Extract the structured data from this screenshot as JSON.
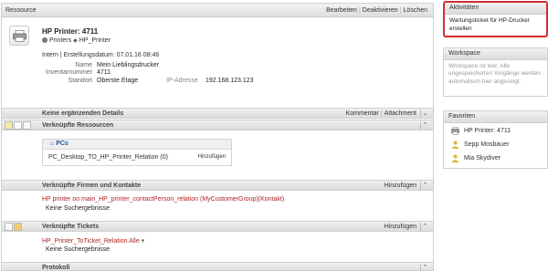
{
  "main": {
    "header_title": "Ressource",
    "actions": [
      "Bearbeiten",
      "Deaktivieren",
      "Löschen"
    ]
  },
  "object": {
    "name": "HP Printer: 4711",
    "crumb_1": "Printers",
    "crumb_2": "HP_Printer",
    "meta_line": "Intern | Erstellungsdatum: 07.01.16 08:46",
    "fields": {
      "name_label": "Name",
      "name_value": "Mein Lieblingsdrucker",
      "inv_label": "Inventarnummer",
      "inv_value": "4711",
      "loc_label": "Standort",
      "loc_value": "Oberste Etage",
      "ip_label": "IP-Adresse",
      "ip_value": "192.168.123.123"
    }
  },
  "details_section": {
    "title": "Keine ergänzenden Details",
    "comment": "Kommentar",
    "attachment": "Attachment"
  },
  "linked_resources": {
    "title": "Verknüpfte Ressourcen",
    "pcs_header": "PCs",
    "relation_name": "PC_Desktop_TO_HP_Printer_Relation (0)",
    "add_label": "Hinzufügen"
  },
  "linked_companies": {
    "title": "Verknüpfte Firmen und Kontakte",
    "add_label": "Hinzufügen",
    "relation_link": "HP printer oo main_HP_printer_contactPerson_relation (MyCustomerGroup)(Kontakt)",
    "empty_text": "Keine Suchergebnisse"
  },
  "linked_tickets": {
    "title": "Verknüpfte Tickets",
    "add_label": "Hinzufügen",
    "relation_link": "HP_Printer_ToTicket_Relation Alle",
    "empty_text": "Keine Suchergebnisse"
  },
  "protocol": {
    "title": "Protokoll"
  },
  "activities": {
    "title": "Aktivitäten",
    "text": "Wartungsticket für HP-Drucker erstellen"
  },
  "workspace": {
    "title": "Workspace",
    "text": "Workspace ist leer. Alle ungespeicherten Vorgänge werden automatisch hier angezeigt."
  },
  "favorites": {
    "title": "Favoriten",
    "items": [
      {
        "label": "HP Printer: 4711",
        "icon": "printer-icon"
      },
      {
        "label": "Sepp Mosbauer",
        "icon": "person-icon"
      },
      {
        "label": "Mia Skydiver",
        "icon": "person-icon"
      }
    ]
  },
  "colors": {
    "red_link": "#b22222",
    "blue_header": "#1b56a0",
    "highlight_border": "#d62c2c"
  }
}
